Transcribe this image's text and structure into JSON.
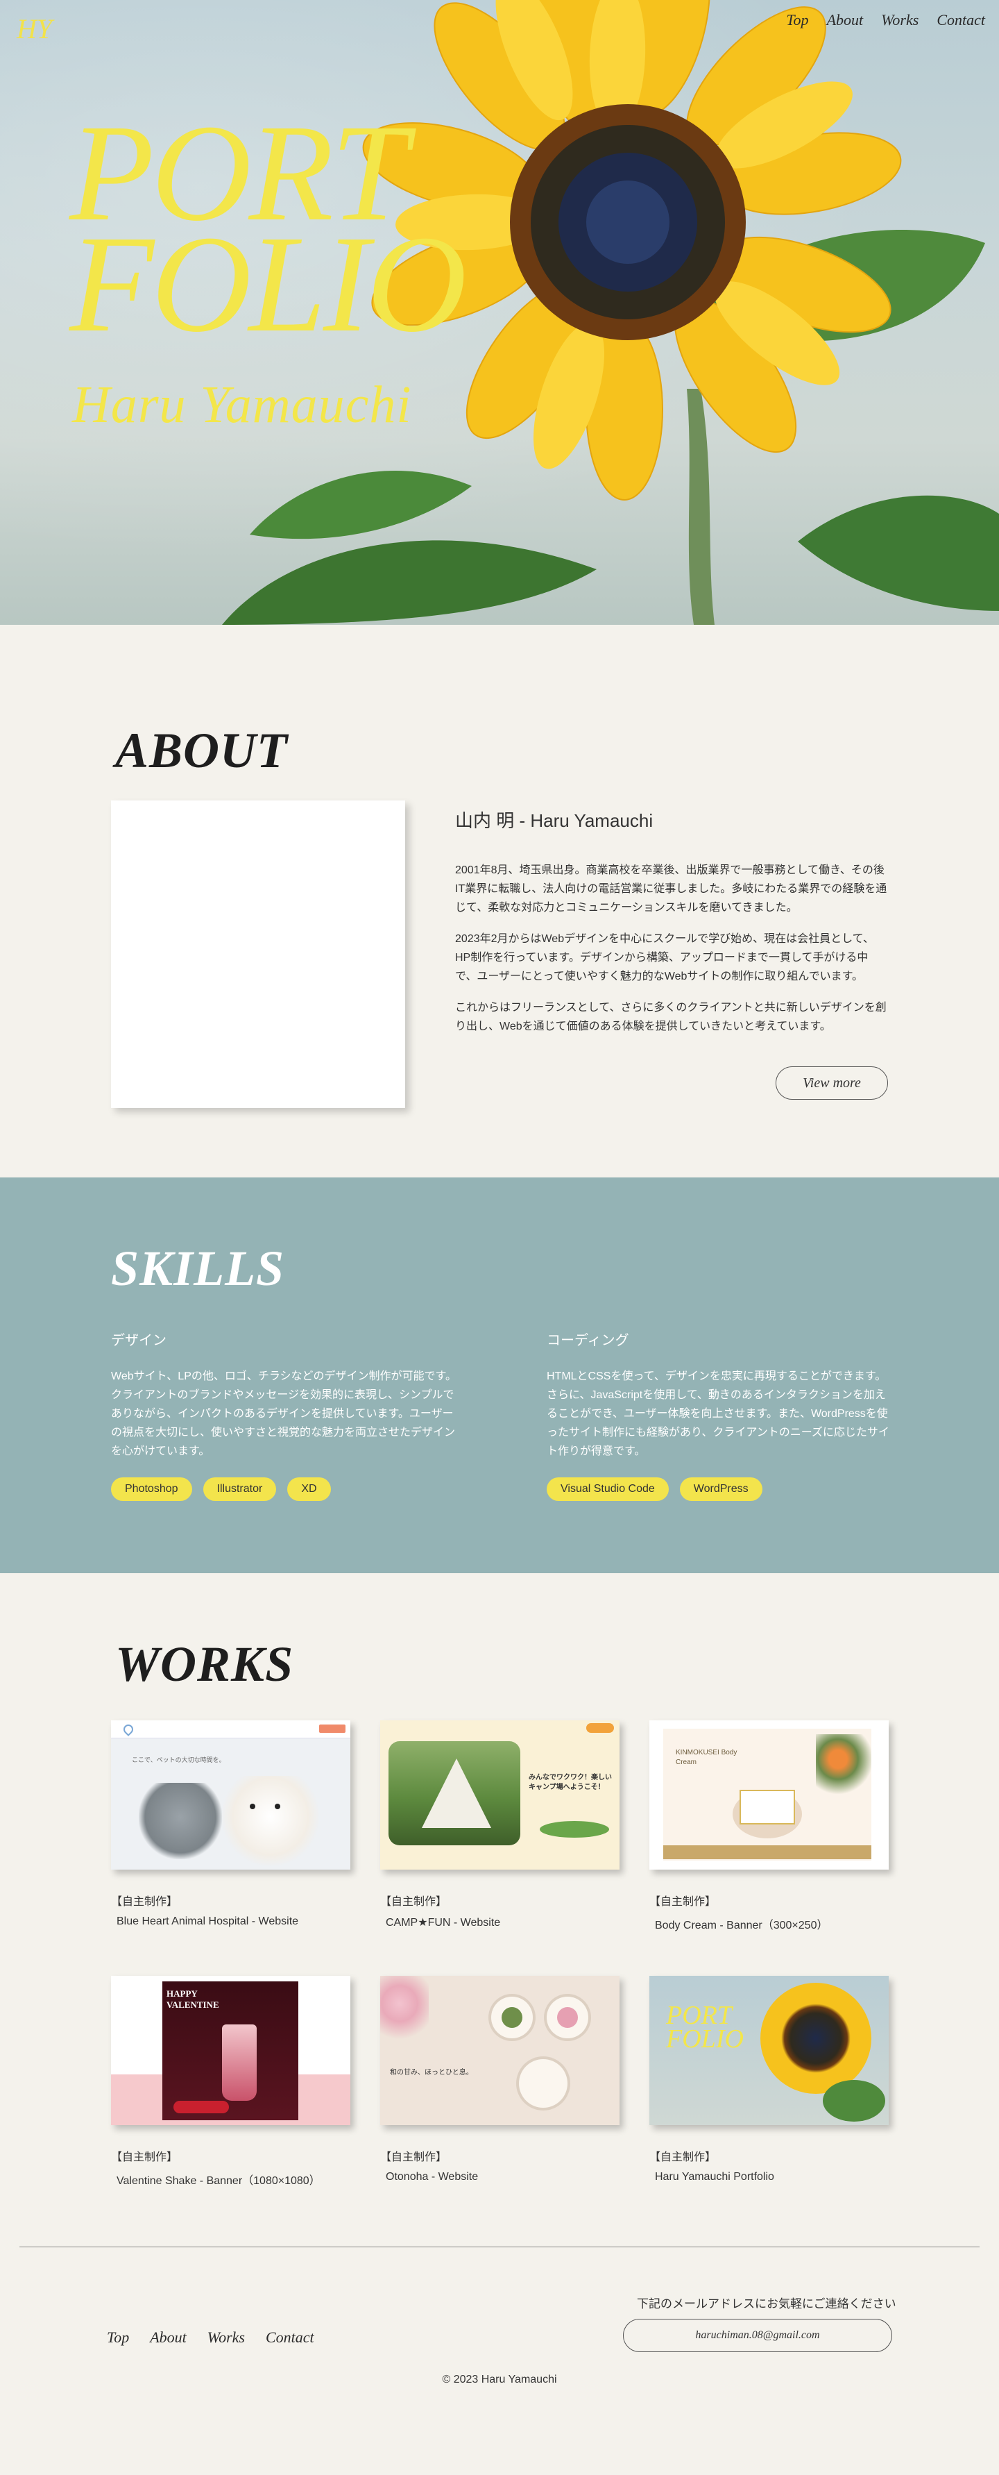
{
  "header": {
    "logo": "HY",
    "nav": [
      "Top",
      "About",
      "Works",
      "Contact"
    ]
  },
  "hero": {
    "title_line1": "PORT",
    "title_line2": "FOLIO",
    "name": "Haru Yamauchi"
  },
  "about": {
    "title": "ABOUT",
    "name": "山内 明 - Haru Yamauchi",
    "paragraphs": [
      "2001年8月、埼玉県出身。商業高校を卒業後、出版業界で一般事務として働き、その後IT業界に転職し、法人向けの電話営業に従事しました。多岐にわたる業界での経験を通じて、柔軟な対応力とコミュニケーションスキルを磨いてきました。",
      "2023年2月からはWebデザインを中心にスクールで学び始め、現在は会社員として、HP制作を行っています。デザインから構築、アップロードまで一貫して手がける中で、ユーザーにとって使いやすく魅力的なWebサイトの制作に取り組んでいます。",
      "これからはフリーランスとして、さらに多くのクライアントと共に新しいデザインを創り出し、Webを通じて価値のある体験を提供していきたいと考えています。"
    ],
    "button": "View more"
  },
  "skills": {
    "title": "SKILLS",
    "columns": [
      {
        "heading": "デザイン",
        "text": "Webサイト、LPの他、ロゴ、チラシなどのデザイン制作が可能です。クライアントのブランドやメッセージを効果的に表現し、シンプルでありながら、インパクトのあるデザインを提供しています。ユーザーの視点を大切にし、使いやすさと視覚的な魅力を両立させたデザインを心がけています。",
        "tags": [
          "Photoshop",
          "Illustrator",
          "XD"
        ]
      },
      {
        "heading": "コーディング",
        "text": "HTMLとCSSを使って、デザインを忠実に再現することができます。さらに、JavaScriptを使用して、動きのあるインタラクションを加えることができ、ユーザー体験を向上させます。また、WordPressを使ったサイト制作にも経験があり、クライアントのニーズに応じたサイト作りが得意です。",
        "tags": [
          "Visual Studio Code",
          "WordPress"
        ]
      }
    ]
  },
  "works": {
    "title": "WORKS",
    "items": [
      {
        "tag": "【自主制作】",
        "title": "Blue Heart Animal Hospital - Website",
        "thumb_caption": "ここで、ペットの大切な時間を。"
      },
      {
        "tag": "【自主制作】",
        "title": "CAMP★FUN - Website",
        "thumb_caption": "みんなでワクワク！楽しいキャンプ場へようこそ！"
      },
      {
        "tag": "【自主制作】",
        "title": "Body Cream - Banner（300×250）",
        "thumb_caption": "KINMOKUSEI Body Cream"
      },
      {
        "tag": "【自主制作】",
        "title": "Valentine Shake - Banner（1080×1080）",
        "thumb_caption": "HAPPY VALENTINE"
      },
      {
        "tag": "【自主制作】",
        "title": "Otonoha - Website",
        "thumb_caption": "和の甘み、ほっとひと息。"
      },
      {
        "tag": "【自主制作】",
        "title": "Haru Yamauchi Portfolio",
        "thumb_caption": "PORT FOLIO"
      }
    ]
  },
  "footer": {
    "nav": [
      "Top",
      "About",
      "Works",
      "Contact"
    ],
    "contact_label": "下記のメールアドレスにお気軽にご連絡ください",
    "email": "haruchiman.08@gmail.com",
    "copyright": "© 2023 Haru Yamauchi"
  },
  "colors": {
    "accent_yellow": "#f3e64a",
    "skills_bg": "#94b3b5",
    "page_bg": "#f4f2ec"
  }
}
